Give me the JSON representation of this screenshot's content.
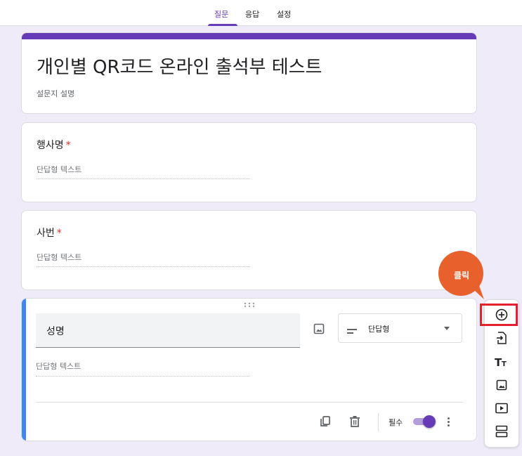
{
  "tabs": {
    "questions": "질문",
    "responses": "응답",
    "settings": "설정"
  },
  "form": {
    "title": "개인별 QR코드 온라인 출석부 테스트",
    "description": "설문지 설명"
  },
  "questions": [
    {
      "title": "행사명",
      "required_mark": "*",
      "answer_placeholder": "단답형 텍스트"
    },
    {
      "title": "사번",
      "required_mark": "*",
      "answer_placeholder": "단답형 텍스트"
    }
  ],
  "active_question": {
    "title": "성명",
    "type_label": "단답형",
    "answer_placeholder": "단답형 텍스트",
    "required_label": "필수",
    "required_on": true
  },
  "side_toolbar": {
    "items": [
      "add-question-icon",
      "import-questions-icon",
      "add-title-icon",
      "add-image-icon",
      "add-video-icon",
      "add-section-icon"
    ]
  },
  "callout": {
    "label": "클릭"
  },
  "colors": {
    "theme": "#673ab7",
    "background": "#f0ebf8",
    "active_bar": "#4285f4",
    "callout": "#e8612c",
    "highlight": "#e5202e",
    "required": "#d93025"
  }
}
